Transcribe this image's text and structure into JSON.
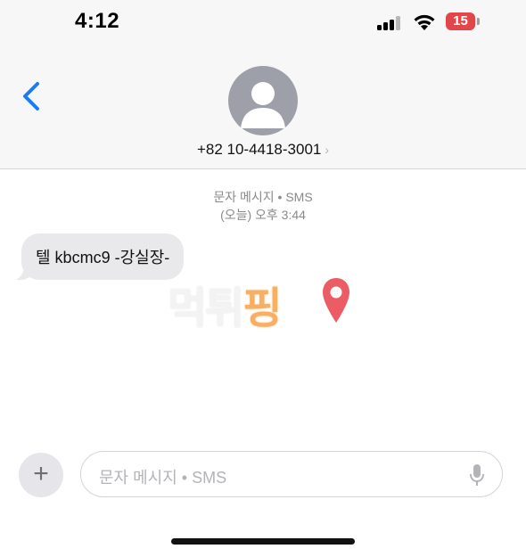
{
  "status_bar": {
    "time": "4:12",
    "battery_level": "15",
    "icons": [
      "cellular-signal-icon",
      "wifi-icon",
      "battery-icon"
    ],
    "battery_color": "#e0464a"
  },
  "header": {
    "back_icon": "chevron-left-icon",
    "accent_color": "#1a7cf5",
    "contact_number": "+82 10-4418-3001",
    "contact_chevron": "›",
    "avatar_icon": "person-silhouette-icon"
  },
  "conversation": {
    "service_label": "문자 메시지 • SMS",
    "timestamp": "(오늘) 오후 3:44",
    "messages": [
      {
        "direction": "incoming",
        "text": "텔 kbcmc9 -강실장-"
      }
    ]
  },
  "watermark": {
    "text": "먹튀핑",
    "colors": [
      "#f2f2f2",
      "#f7a24a",
      "#e8404a"
    ]
  },
  "composer": {
    "add_icon": "plus-icon",
    "add_symbol": "+",
    "placeholder": "문자 메시지 • SMS",
    "mic_icon": "microphone-icon"
  }
}
